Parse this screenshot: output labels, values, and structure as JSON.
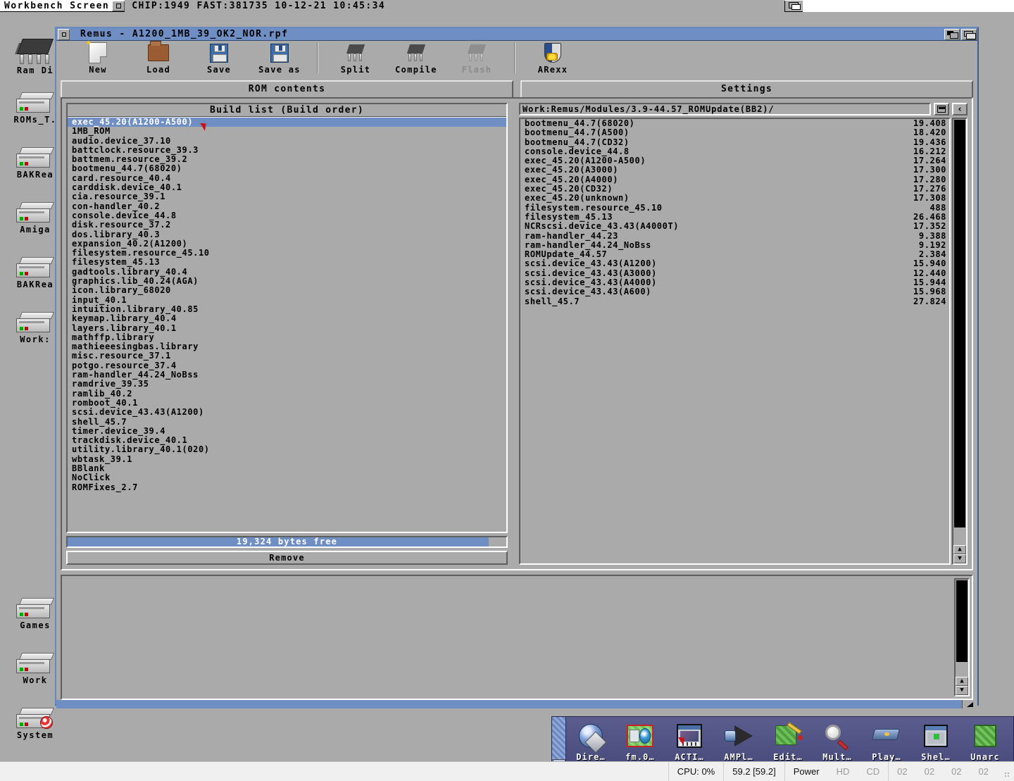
{
  "screen": {
    "title": "Workbench Screen",
    "meminfo": "CHIP:1949 FAST:381735 10-12-21 10:45:34",
    "depth_icon": "depth-gadget-icon"
  },
  "desktop_icons": [
    {
      "label": "Ram Di",
      "icon": "ram-chip-icon"
    },
    {
      "label": "ROMs_T.",
      "icon": "harddrive-icon"
    },
    {
      "label": "BAKRea",
      "icon": "harddrive-icon"
    },
    {
      "label": "Amiga",
      "icon": "harddrive-icon"
    },
    {
      "label": "BAKRea",
      "icon": "harddrive-icon"
    },
    {
      "label": "Work:",
      "icon": "harddrive-icon"
    },
    {
      "label": "Games",
      "icon": "harddrive-icon"
    },
    {
      "label": "Work",
      "icon": "harddrive-icon"
    },
    {
      "label": "System",
      "icon": "harddrive-boing-icon"
    }
  ],
  "window": {
    "title": "Remus - A1200_1MB_39_OK2_NOR.rpf",
    "close_icon": "close-gadget-icon",
    "zoom_icon": "zoom-gadget-icon",
    "depth_icon": "depth-gadget-icon"
  },
  "toolbar": [
    {
      "label": "New",
      "icon": "new-page-icon",
      "disabled": false
    },
    {
      "label": "Load",
      "icon": "folder-icon",
      "disabled": false
    },
    {
      "label": "Save",
      "icon": "floppy-disk-icon",
      "disabled": false
    },
    {
      "label": "Save as",
      "icon": "floppy-disk-icon",
      "disabled": false
    },
    {
      "label": "Split",
      "icon": "chip-icon",
      "disabled": false
    },
    {
      "label": "Compile",
      "icon": "chip-icon",
      "disabled": false
    },
    {
      "label": "Flash",
      "icon": "chip-icon",
      "disabled": true
    },
    {
      "label": "ARexx",
      "icon": "arexx-shield-icon",
      "disabled": false
    }
  ],
  "tabs": [
    {
      "label": "ROM contents",
      "selected": true
    },
    {
      "label": "Settings",
      "selected": false
    }
  ],
  "build_list": {
    "title": "Build list (Build order)",
    "selected_index": 0,
    "items": [
      "exec_45.20(A1200-A500)",
      "1MB_ROM",
      "audio.device_37.10",
      "battclock.resource_39.3",
      "battmem.resource_39.2",
      "bootmenu_44.7(68020)",
      "card.resource_40.4",
      "carddisk.device_40.1",
      "cia.resource_39.1",
      "con-handler_40.2",
      "console.device_44.8",
      "disk.resource_37.2",
      "dos.library_40.3",
      "expansion_40.2(A1200)",
      "filesystem.resource_45.10",
      "filesystem_45.13",
      "gadtools.library_40.4",
      "graphics.lib_40.24(AGA)",
      "icon.library_68020",
      "input_40.1",
      "intuition.library_40.85",
      "keymap.library_40.4",
      "layers.library_40.1",
      "mathffp.library",
      "mathieeesingbas.library",
      "misc.resource_37.1",
      "potgo.resource_37.4",
      "ram-handler_44.24_NoBss",
      "ramdrive_39.35",
      "ramlib_40.2",
      "romboot_40.1",
      "scsi.device_43.43(A1200)",
      "shell_45.7",
      "timer.device_39.4",
      "trackdisk.device_40.1",
      "utility.library_40.1(020)",
      "wbtask_39.1",
      "BBlank",
      "NoClick",
      "ROMFixes_2.7"
    ]
  },
  "free_bar": {
    "text": "19,324 bytes free",
    "fill_percent": 96
  },
  "remove_button": {
    "label": "Remove",
    "accesskey": "R"
  },
  "module_browser": {
    "path": "Work:Remus/Modules/3.9-44.57_ROMUpdate(BB2)/",
    "drawer_icon": "drawer-icon",
    "parent_icon": "parent-drawer-icon",
    "rows": [
      {
        "name": "bootmenu_44.7(68020)",
        "size": "19.408"
      },
      {
        "name": "bootmenu_44.7(A500)",
        "size": "18.420"
      },
      {
        "name": "bootmenu_44.7(CD32)",
        "size": "19.436"
      },
      {
        "name": "console.device_44.8",
        "size": "16.212"
      },
      {
        "name": "exec_45.20(A1200-A500)",
        "size": "17.264"
      },
      {
        "name": "exec_45.20(A3000)",
        "size": "17.300"
      },
      {
        "name": "exec_45.20(A4000)",
        "size": "17.280"
      },
      {
        "name": "exec_45.20(CD32)",
        "size": "17.276"
      },
      {
        "name": "exec_45.20(unknown)",
        "size": "17.308"
      },
      {
        "name": "filesystem.resource_45.10",
        "size": "488"
      },
      {
        "name": "filesystem_45.13",
        "size": "26.468"
      },
      {
        "name": "NCRscsi.device_43.43(A4000T)",
        "size": "17.352"
      },
      {
        "name": "ram-handler_44.23",
        "size": "9.388"
      },
      {
        "name": "ram-handler_44.24_NoBss",
        "size": "9.192"
      },
      {
        "name": "ROMUpdate_44.57",
        "size": "2.384"
      },
      {
        "name": "scsi.device_43.43(A1200)",
        "size": "15.940"
      },
      {
        "name": "scsi.device_43.43(A3000)",
        "size": "12.440"
      },
      {
        "name": "scsi.device_43.43(A4000)",
        "size": "15.944"
      },
      {
        "name": "scsi.device_43.43(A600)",
        "size": "15.968"
      },
      {
        "name": "shell_45.7",
        "size": "27.824"
      }
    ]
  },
  "log_window": {
    "text": ""
  },
  "dock": {
    "handle_icon": "dock-collapse-arrow-icon",
    "items": [
      {
        "label": "Dire…",
        "icon": "directory-opus-icon"
      },
      {
        "label": "fm.0…",
        "icon": "filemanager-icon"
      },
      {
        "label": "ACTI…",
        "icon": "action-viewer-icon"
      },
      {
        "label": "AMPl…",
        "icon": "amplifier-speaker-icon"
      },
      {
        "label": "Edit…",
        "icon": "text-editor-icon"
      },
      {
        "label": "Mult…",
        "icon": "magnifier-icon"
      },
      {
        "label": "Play…",
        "icon": "player-icon"
      },
      {
        "label": "Shel…",
        "icon": "shell-icon"
      },
      {
        "label": "Unarc",
        "icon": "unarchive-cube-icon"
      }
    ]
  },
  "statusbar": {
    "cpu": "CPU: 0%",
    "fps": "59.2 [59.2]",
    "power": "Power",
    "hd": "HD",
    "cd": "CD",
    "drives": [
      "02",
      "02",
      "02",
      "02"
    ]
  },
  "colors": {
    "desktop_gray": "#aaaaaa",
    "title_blue": "#6f8fc4",
    "selection_blue": "#6f8fc4",
    "dock_purple": "#4a4d7d",
    "cursor_red": "#d01010"
  }
}
